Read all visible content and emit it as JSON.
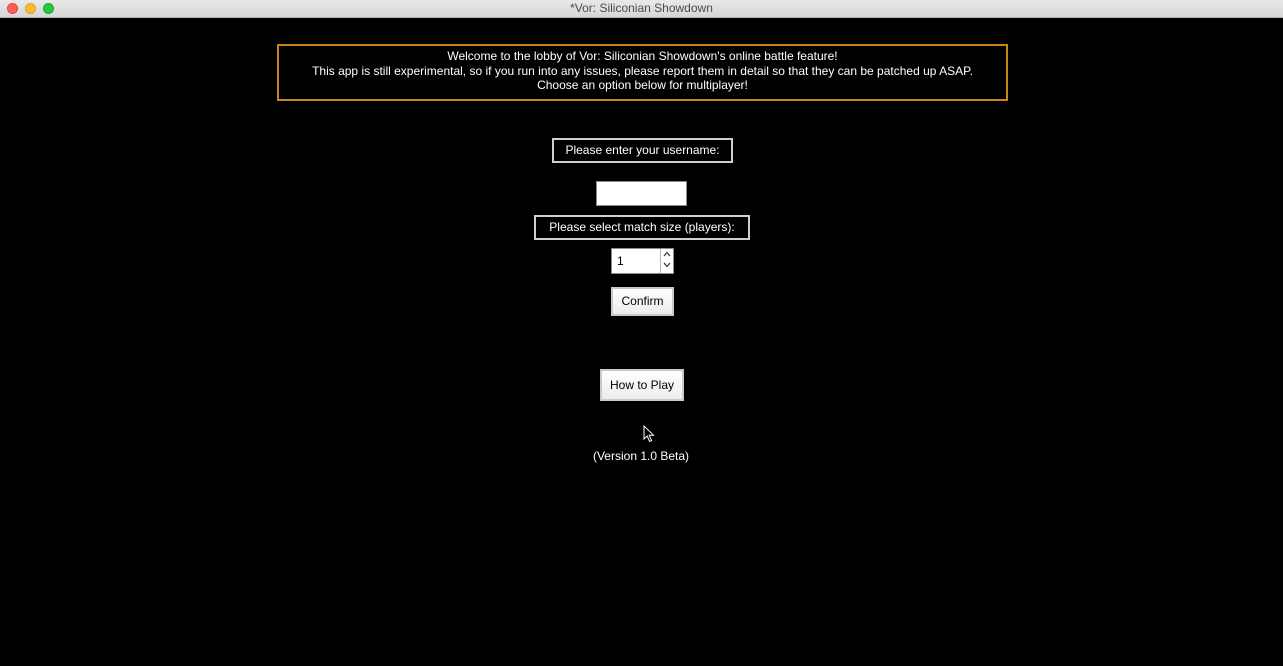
{
  "window": {
    "title": "*Vor: Siliconian Showdown"
  },
  "banner": {
    "line1": "Welcome to the lobby of Vor: Siliconian Showdown's online battle feature!",
    "line2": "This app is still experimental, so if you run into any issues, please report them in detail so that they can be patched up ASAP.",
    "line3": "Choose an option below for multiplayer!"
  },
  "username": {
    "label": "Please enter your username:",
    "value": "",
    "placeholder": ""
  },
  "match_size": {
    "label": "Please select match size (players):",
    "value": "1"
  },
  "buttons": {
    "confirm_label": "Confirm",
    "how_to_play_label": "How to Play"
  },
  "version": "(Version 1.0 Beta)",
  "icons": {
    "close": "close-icon",
    "minimize": "minimize-icon",
    "maximize": "maximize-icon",
    "spin_up": "chevron-up-icon",
    "spin_down": "chevron-down-icon",
    "cursor": "mouse-cursor-icon"
  },
  "colors": {
    "background": "#000000",
    "banner_border": "#c8861a",
    "label_border": "#cfcfcf",
    "text": "#ffffff"
  }
}
